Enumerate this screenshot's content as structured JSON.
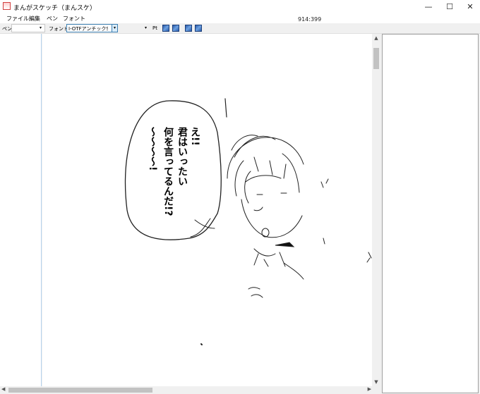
{
  "window": {
    "title": "まんがスケッチ（まんスケ）",
    "min_glyph": "—",
    "max_glyph": "☐",
    "close_glyph": "✕"
  },
  "menu": {
    "items": [
      "ファイル",
      "編集",
      "ペン",
      "フォント"
    ],
    "coords": "914:399"
  },
  "toolbar": {
    "pen_label": "ペン:",
    "pen_value": "",
    "font_label": "フォント:",
    "font_value": "I-OTFアンチックStd E",
    "size_value": "",
    "pt_label": "Pt",
    "dropdown_glyph": "▾"
  },
  "canvas": {
    "bubble_lines": [
      "え!!",
      "君はいったい",
      "何を言ってるんだ!?",
      "〜〜〜〜!"
    ]
  },
  "scroll": {
    "up": "▲",
    "down": "▼",
    "left": "◀",
    "right": "▶"
  }
}
